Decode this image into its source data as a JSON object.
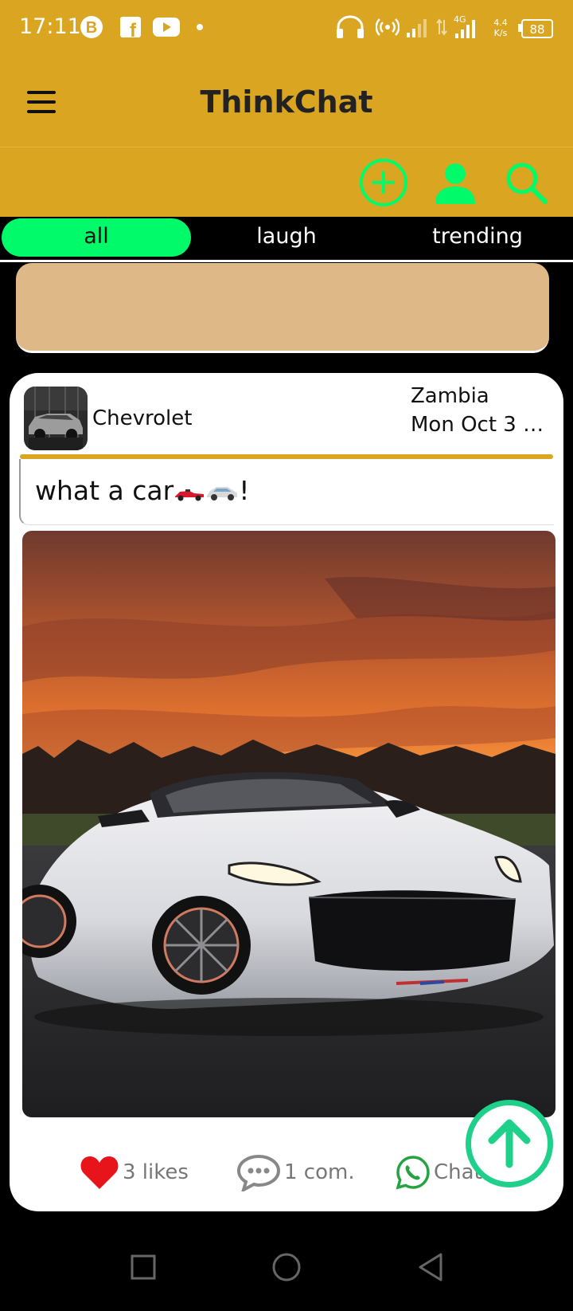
{
  "status_bar": {
    "time": "17:11",
    "battery": "88",
    "net_speed": "4.4\nK/s",
    "network": "4G",
    "left_icons": [
      "b-circle-icon",
      "facebook-icon",
      "youtube-icon",
      "dot-icon"
    ],
    "right_icons": [
      "headphones-icon",
      "hotspot-icon",
      "signal-icon",
      "signal-icon",
      "battery-icon"
    ]
  },
  "app_bar": {
    "title": "ThinkChat",
    "menu_icon": "hamburger-icon"
  },
  "toolbar": {
    "icons": [
      "add-circle-icon",
      "profile-icon",
      "search-icon"
    ],
    "accent": "#00FA6A"
  },
  "tabs": [
    {
      "label": "all",
      "active": true
    },
    {
      "label": "laugh",
      "active": false
    },
    {
      "label": "trending",
      "active": false
    }
  ],
  "post": {
    "author": "Chevrolet",
    "location": "Zambia",
    "date": "Mon Oct  3 1...",
    "caption": "what a car",
    "caption_suffix": "!",
    "caption_emoji": [
      "race-car-emoji",
      "car-emoji"
    ],
    "likes_label": "3 likes",
    "comments_label": "1 com.",
    "chat_label": "Chat"
  },
  "colors": {
    "brand": "#DAA520",
    "accent": "#00FA6A",
    "banner": "#DEB887",
    "heart": "#E8141C",
    "whatsapp": "#25A244"
  },
  "nav_bar": {
    "buttons": [
      "recents-square-icon",
      "home-circle-icon",
      "back-triangle-icon"
    ]
  }
}
